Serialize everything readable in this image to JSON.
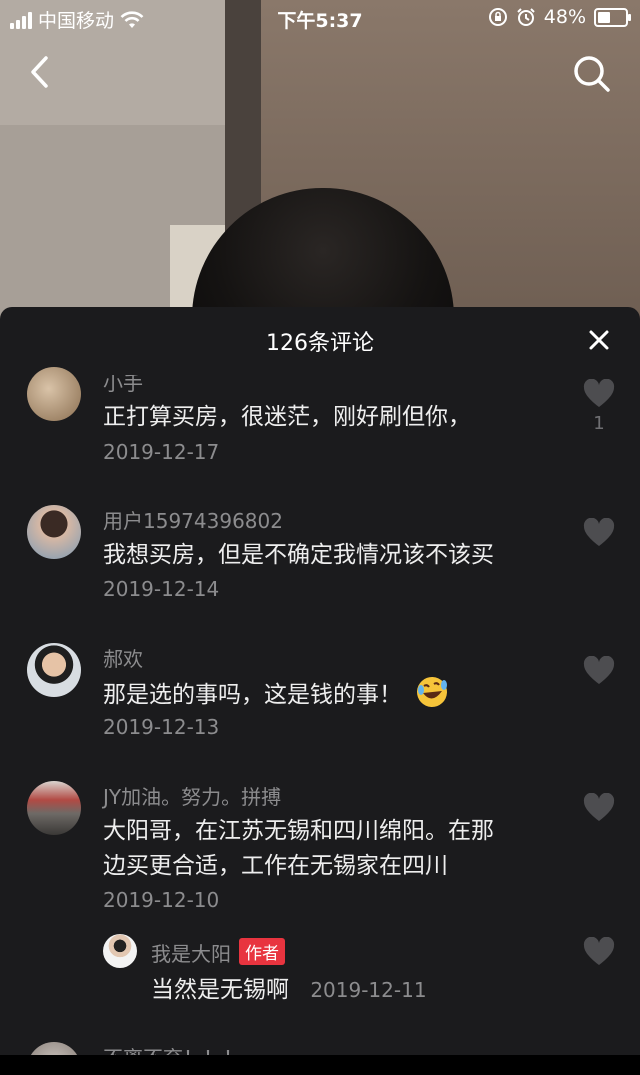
{
  "status": {
    "carrier": "中国移动",
    "time": "下午5:37",
    "battery": "48%",
    "battery_level": 0.48
  },
  "nav": {
    "back_icon": "chevron-left-icon",
    "search_icon": "search-icon"
  },
  "sheet": {
    "title": "126条评论"
  },
  "comments": [
    {
      "name": "小手",
      "text": "正打算买房，很迷茫，刚好刷但你，",
      "date": "2019-12-17",
      "likes": "1"
    },
    {
      "name": "用户15974396802",
      "text": "我想买房，但是不确定我情况该不该买",
      "date": "2019-12-14"
    },
    {
      "name": "郝欢",
      "text": "那是选的事吗，这是钱的事！",
      "date": "2019-12-13"
    },
    {
      "name": "JY加油。努力。拼搏",
      "text_line1": "大阳哥，在江苏无锡和四川绵阳。在那",
      "text_line2": "边买更合适，工作在无锡家在四川",
      "date": "2019-12-10"
    },
    {
      "name": "我是大阳",
      "tag": "作者",
      "text": "当然是无锡啊",
      "date": "2019-12-11"
    },
    {
      "name": "不离不弃！！！"
    }
  ],
  "colors": {
    "accent": "#e8343f",
    "sheet_bg": "#1b1b1d"
  }
}
